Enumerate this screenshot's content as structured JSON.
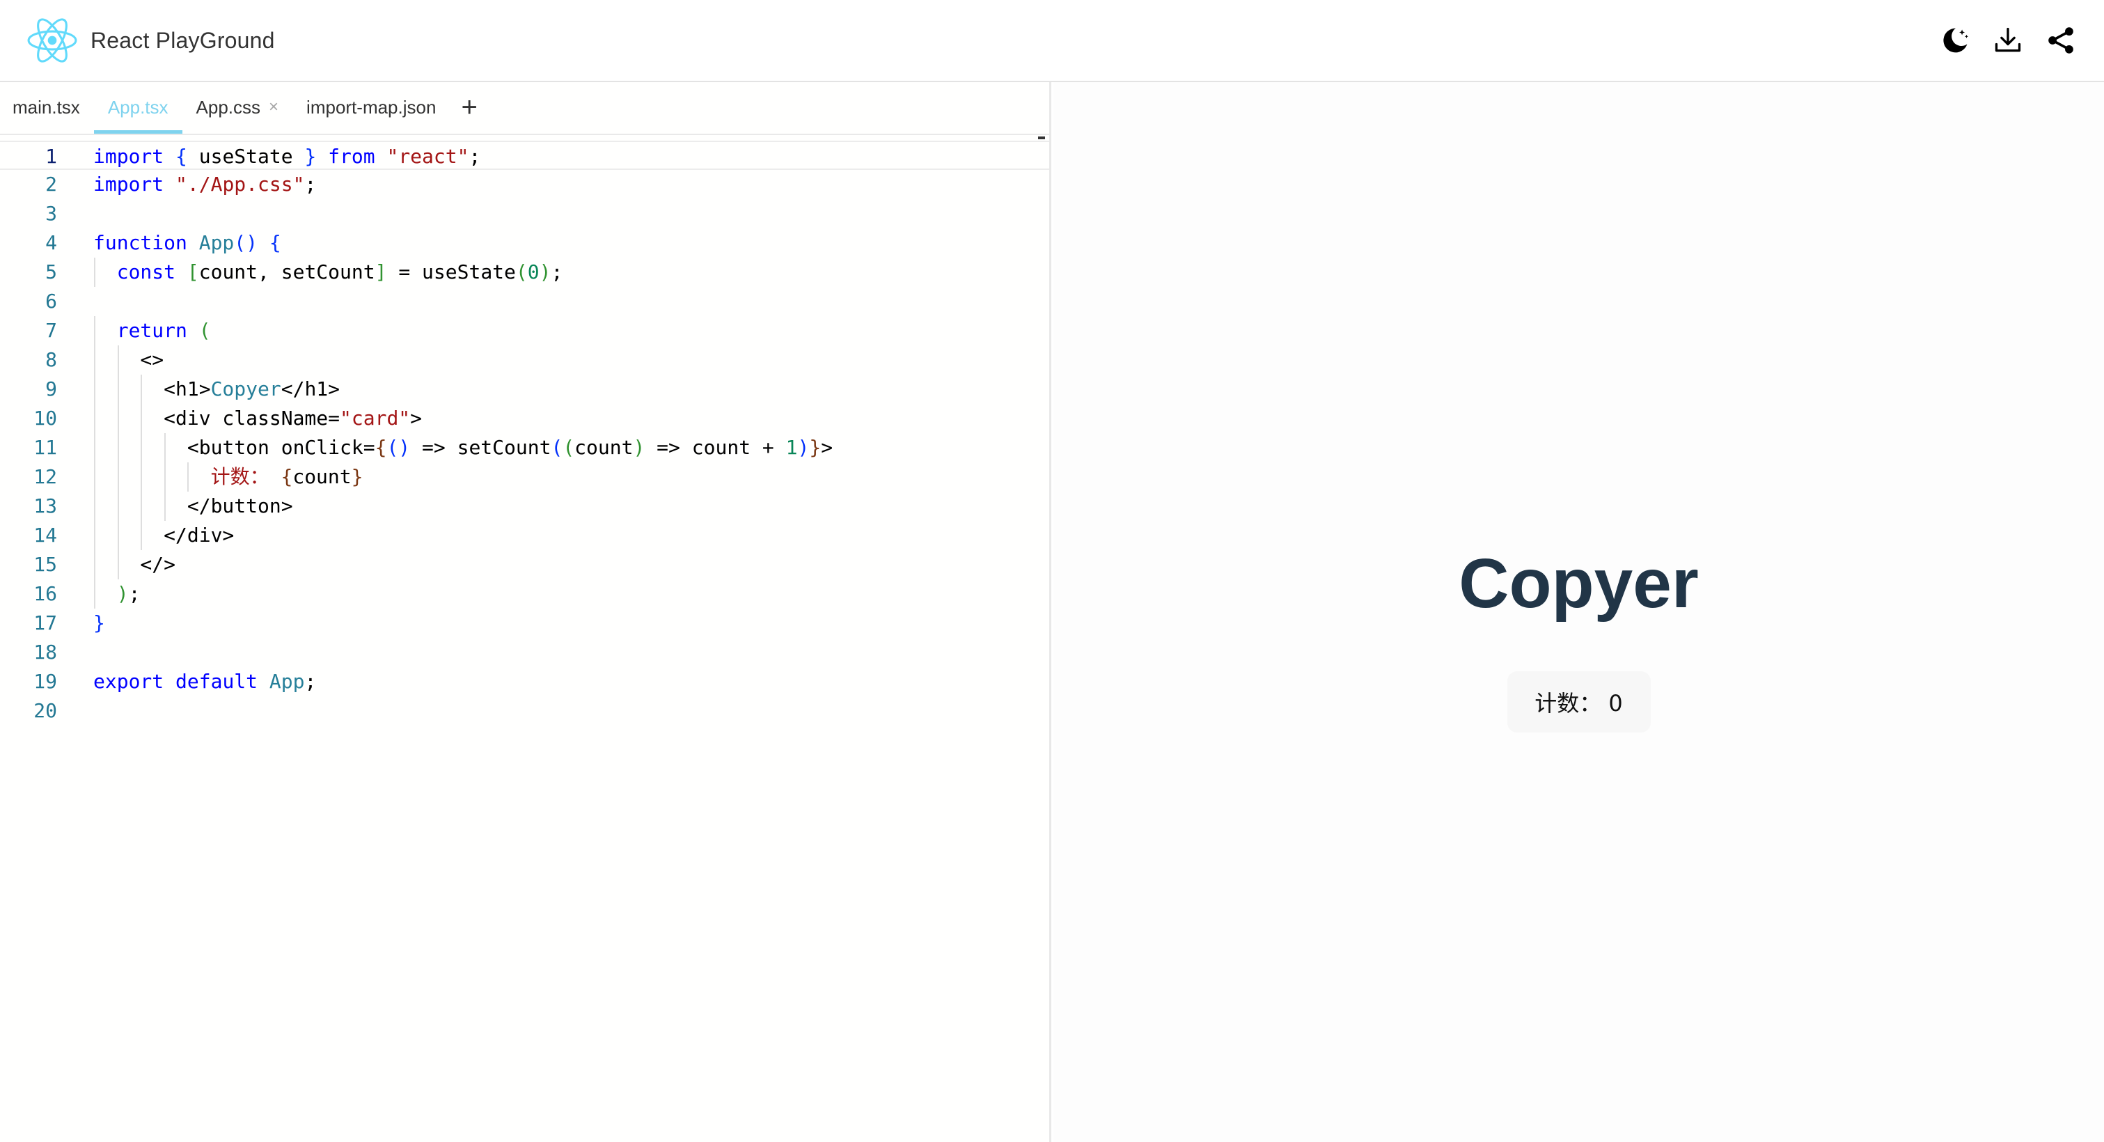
{
  "app": {
    "title": "React PlayGround",
    "accent_color": "#61dafb"
  },
  "header": {
    "actions": [
      {
        "name": "theme-toggle",
        "icon": "moon-icon"
      },
      {
        "name": "download",
        "icon": "download-icon"
      },
      {
        "name": "share",
        "icon": "share-icon"
      }
    ]
  },
  "tabs": [
    {
      "label": "main.tsx",
      "active": false,
      "closable": false
    },
    {
      "label": "App.tsx",
      "active": true,
      "closable": false
    },
    {
      "label": "App.css",
      "active": false,
      "closable": true
    },
    {
      "label": "import-map.json",
      "active": false,
      "closable": false
    }
  ],
  "tab_close_glyph": "×",
  "tab_add_glyph": "+",
  "editor": {
    "active_line": 1,
    "lines": [
      "import { useState } from \"react\";",
      "import \"./App.css\";",
      "",
      "function App() {",
      "  const [count, setCount] = useState(0);",
      "",
      "  return (",
      "    <>",
      "      <h1>Copyer</h1>",
      "      <div className=\"card\">",
      "        <button onClick={() => setCount((count) => count + 1)}>",
      "          计数： {count}",
      "        </button>",
      "      </div>",
      "    </>",
      "  );",
      "}",
      "",
      "export default App;",
      ""
    ]
  },
  "preview": {
    "heading": "Copyer",
    "button_label": "计数： 0"
  }
}
